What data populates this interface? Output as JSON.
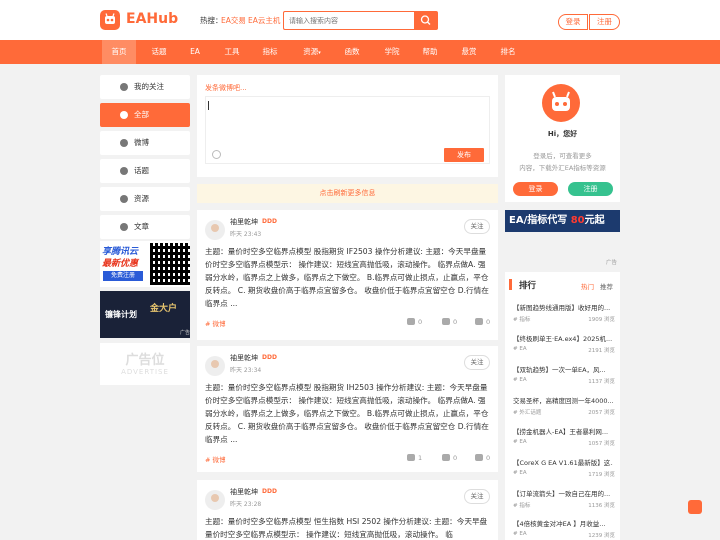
{
  "header": {
    "logo_text": "EAHub",
    "hot_label": "热搜：",
    "hot_links": [
      "EA交易",
      "EA云主机"
    ],
    "search_placeholder": "请输入搜索内容",
    "login": "登录",
    "register": "注册"
  },
  "nav": [
    "首页",
    "话题",
    "EA",
    "工具",
    "指标",
    "资源",
    "函数",
    "学院",
    "帮助",
    "悬赏",
    "排名"
  ],
  "left_nav": [
    "我的关注",
    "全部",
    "微博",
    "话题",
    "资源",
    "文章"
  ],
  "left_ads": {
    "ad1": [
      "享腾讯云",
      "最新优惠",
      "免费注册"
    ],
    "ad2": [
      "镰锋计划",
      "金大户"
    ],
    "ad_label": "广告",
    "ad3": [
      "广告位",
      "ADVERTISE"
    ]
  },
  "compose": {
    "placeholder": "发条微博吧...",
    "publish": "发布",
    "refresh": "点击刷新更多信息"
  },
  "posts": [
    {
      "user": "袖里乾坤",
      "badge": "DDD",
      "time": "昨天 23:43",
      "follow": "关注",
      "body": "主题：量价时空多空临界点模型 股指期货 IF2503 操作分析建议: 主题：今天早盘量价时空多空临界点模型示： 操作建议：短线宜高抛低吸，滚动操作。 临界点做A. 强弱分水岭，临界点之上做多，临界点之下做空。 B.临界点可做止损点，止赢点，平仓反转点。 C. 期货收盘价高于临界点宜留多仓。 收盘价低于临界点宜留空仓 D.行情在临界点 ...",
      "tag": "# 微博",
      "comments": "0",
      "favs": "0",
      "likes": "0"
    },
    {
      "user": "袖里乾坤",
      "badge": "DDD",
      "time": "昨天 23:34",
      "follow": "关注",
      "body": "主题：量价时空多空临界点模型 股指期货 IH2503 操作分析建议: 主题：今天早盘量价时空多空临界点模型示： 操作建议：短线宜高抛低吸，滚动操作。 临界点做A. 强弱分水岭，临界点之上做多，临界点之下做空。 B.临界点可做止损点，止赢点，平仓反转点。 C. 期货收盘价高于临界点宜留多仓。 收盘价低于临界点宜留空仓 D.行情在临界点 ...",
      "tag": "# 微博",
      "comments": "1",
      "favs": "0",
      "likes": "0"
    },
    {
      "user": "袖里乾坤",
      "badge": "DDD",
      "time": "昨天 23:28",
      "follow": "关注",
      "body": "主题：量价时空多空临界点模型 恒生指数 HSI 2502 操作分析建议: 主题：今天早盘量价时空多空临界点模型示： 操作建议：短线宜高抛低吸，滚动操作。 临"
    }
  ],
  "user_box": {
    "greeting": "Hi，您好",
    "hint1": "登录后，可查看更多",
    "hint2": "内容，下载外汇EA指标等资源",
    "login": "登录",
    "register": "注册"
  },
  "banner": {
    "text": "EA/指标代写",
    "price": "80",
    "unit": "元起",
    "ad_label": "广告"
  },
  "ranking": {
    "title": "排行",
    "tab_hot": "热门",
    "tab_rec": "推荐",
    "items": [
      {
        "title": "【新图趋势线通用版】收好用的...",
        "cat": "# 指标",
        "views": "1909 浏览"
      },
      {
        "title": "【终极刷单王·EA.ex4】2025机...",
        "cat": "# EA",
        "views": "2191 浏览"
      },
      {
        "title": "【双轨趋势】一次一单EA，风...",
        "cat": "# EA",
        "views": "1137 浏览"
      },
      {
        "title": "交易圣杯，高精度回测一年4000...",
        "cat": "# 外汇话题",
        "views": "2057 浏览"
      },
      {
        "title": "【捞金机器人-EA】王者暴利网...",
        "cat": "# EA",
        "views": "1057 浏览"
      },
      {
        "title": "【CoreX G EA V1.61最新版】这...",
        "cat": "# EA",
        "views": "1719 浏览"
      },
      {
        "title": "【订单流箭头】一致自己在用的...",
        "cat": "# 指标",
        "views": "1136 浏览"
      },
      {
        "title": "【4倍核黄金对冲EA 】月收益...",
        "cat": "# EA",
        "views": "1239 浏览"
      }
    ]
  },
  "colors": {
    "accent": "#ff6a39",
    "green": "#36c28f"
  }
}
